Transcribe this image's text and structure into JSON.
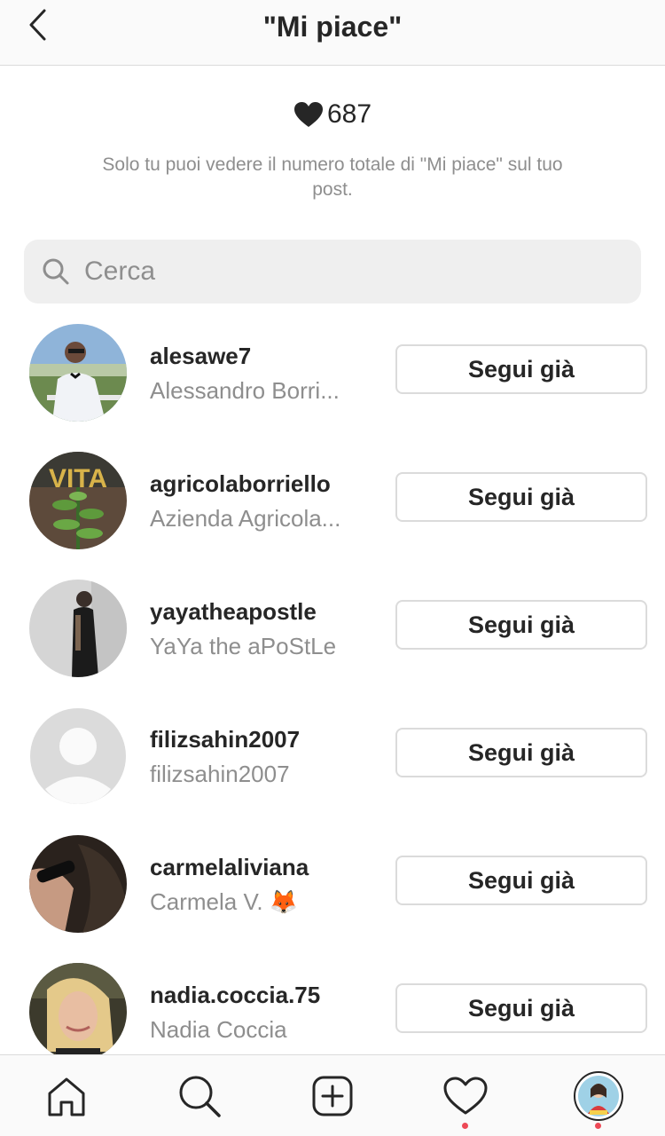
{
  "header": {
    "title": "\"Mi piace\""
  },
  "likes": {
    "count": "687",
    "note": "Solo tu puoi vedere il numero totale di \"Mi piace\" sul tuo post."
  },
  "search": {
    "placeholder": "Cerca"
  },
  "users": [
    {
      "username": "alesawe7",
      "fullname": "Alessandro Borri...",
      "button": "Segui già"
    },
    {
      "username": "agricolaborriello",
      "fullname": "Azienda Agricola...",
      "button": "Segui già"
    },
    {
      "username": "yayatheapostle",
      "fullname": "YaYa the aPoStLe",
      "button": "Segui già"
    },
    {
      "username": "filizsahin2007",
      "fullname": "filizsahin2007",
      "button": "Segui già"
    },
    {
      "username": "carmelaliviana",
      "fullname": "Carmela V. 🦊",
      "button": "Segui già"
    },
    {
      "username": "nadia.coccia.75",
      "fullname": "Nadia Coccia",
      "button": "Segui già"
    }
  ],
  "avatars": [
    {
      "label": "VITA"
    }
  ],
  "colors": {
    "accent_dot": "#ed4956",
    "secondary_text": "#8e8e8e",
    "border": "#dbdbdb"
  },
  "tabs": [
    "home-icon",
    "search-icon",
    "add-post-icon",
    "activity-heart-icon",
    "profile-avatar"
  ]
}
